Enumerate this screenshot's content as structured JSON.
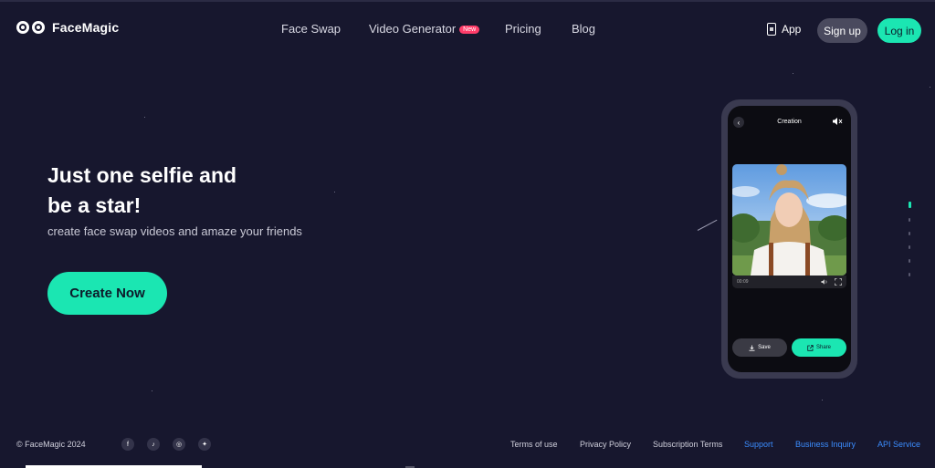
{
  "header": {
    "brand": "FaceMagic",
    "nav": [
      {
        "label": "Face Swap"
      },
      {
        "label": "Video Generator",
        "badge": "New"
      },
      {
        "label": "Pricing"
      },
      {
        "label": "Blog"
      }
    ],
    "app_label": "App",
    "signup_label": "Sign up",
    "login_label": "Log in"
  },
  "hero": {
    "title_line1": "Just one selfie and",
    "title_line2": "be a star!",
    "subtitle": "create face swap videos and amaze your friends",
    "cta_label": "Create Now"
  },
  "phone": {
    "title": "Creation",
    "time": "00:09",
    "save_label": "Save",
    "share_label": "Share"
  },
  "slides": {
    "count": 6,
    "active_index": 0
  },
  "footer": {
    "copyright": "© FaceMagic 2024",
    "socials": [
      "facebook-icon",
      "tiktok-icon",
      "instagram-icon",
      "twitter-icon"
    ],
    "links": [
      "Terms of use",
      "Privacy Policy",
      "Subscription Terms",
      "Support",
      "Business Inquiry",
      "API Service"
    ]
  },
  "colors": {
    "background": "#17172e",
    "accent": "#1be6b2",
    "badge": "#ff3d6a",
    "link_blue": "#3b8dff"
  }
}
